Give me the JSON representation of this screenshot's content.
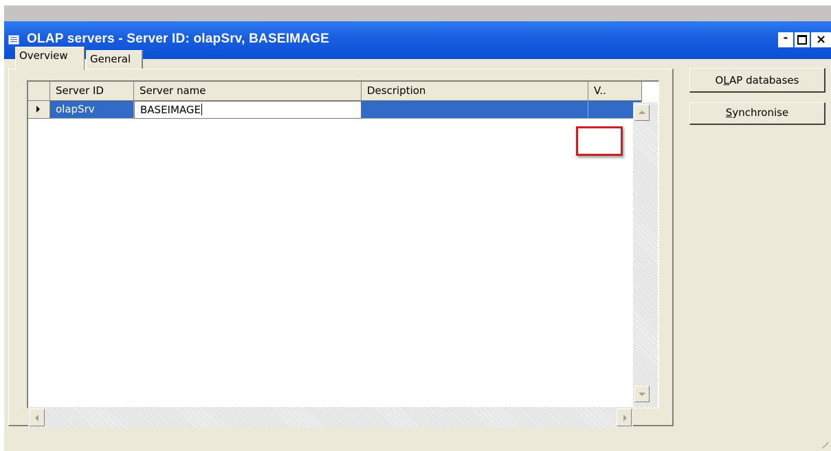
{
  "window": {
    "title": "OLAP servers - Server ID: olapSrv, BASEIMAGE",
    "minimize_glyph": "-",
    "close_glyph": "×",
    "icon": "form-icon"
  },
  "tabs": [
    {
      "label": "Overview",
      "selected": true
    },
    {
      "label": "General",
      "selected": false
    }
  ],
  "grid": {
    "columns": [
      "Server ID",
      "Server name",
      "Description",
      "V.."
    ],
    "rows": [
      {
        "server_id": "olapSrv",
        "server_name": "BASEIMAGE",
        "description": "",
        "v": ""
      }
    ]
  },
  "buttons": {
    "olap_databases": {
      "pre": "O",
      "accel": "L",
      "post": "AP databases"
    },
    "synchronise": {
      "pre": "",
      "accel": "S",
      "post": "ynchronise"
    }
  },
  "colors": {
    "title_bar": "#0a4fd4",
    "selection": "#316ac5",
    "highlight_box": "#cc1f1f",
    "face": "#ece9d8"
  }
}
